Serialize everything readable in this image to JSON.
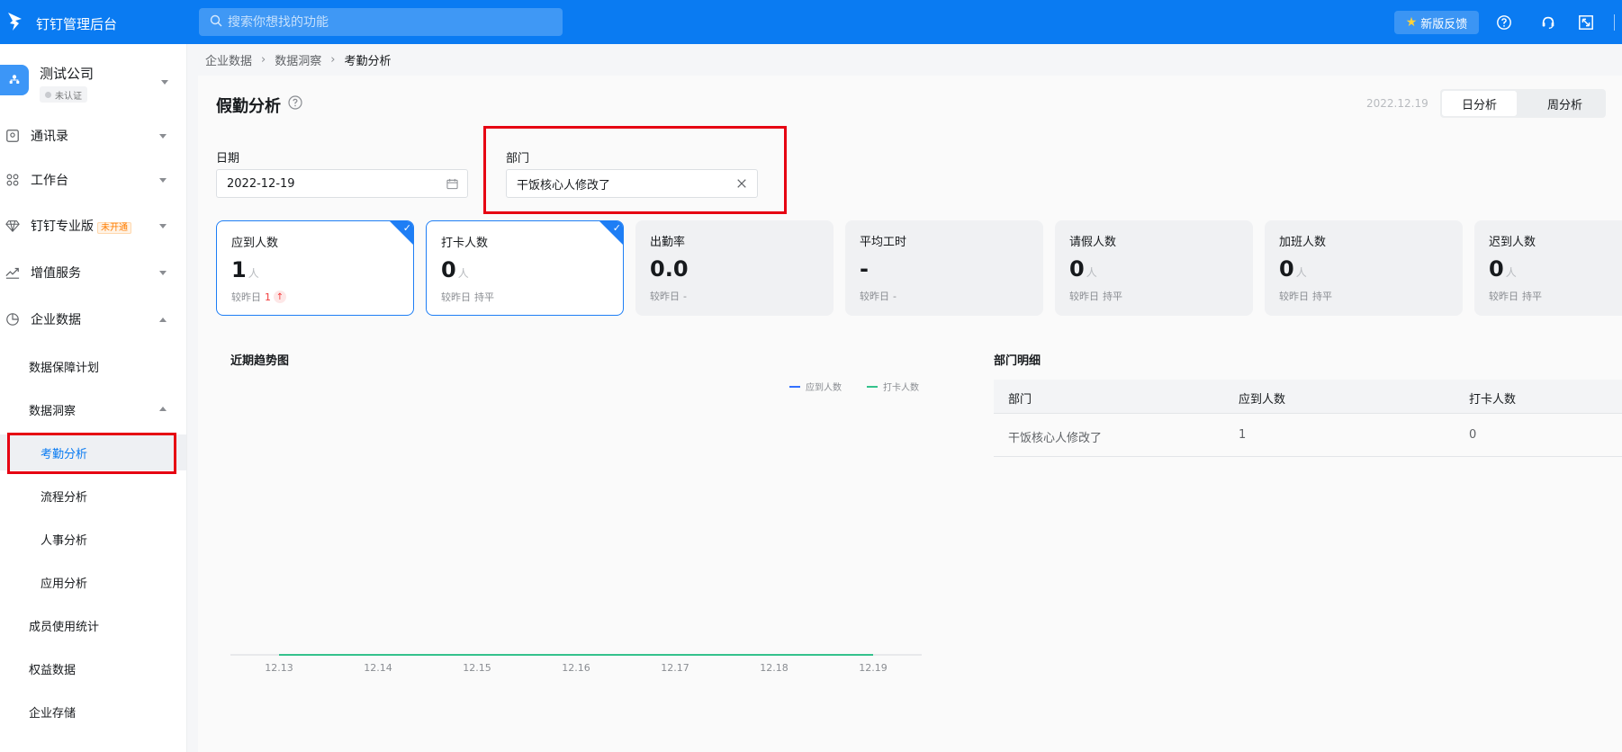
{
  "topbar": {
    "title": "钉钉管理后台",
    "search_placeholder": "搜索你想找的功能",
    "feedback_label": "新版反馈"
  },
  "sidebar": {
    "company_name": "测试公司",
    "company_badge": "未认证",
    "items": [
      {
        "label": "通讯录",
        "icon": "contacts-icon"
      },
      {
        "label": "工作台",
        "icon": "grid-icon"
      },
      {
        "label": "钉钉专业版",
        "icon": "diamond-icon",
        "tag": "未开通"
      },
      {
        "label": "增值服务",
        "icon": "trend-icon"
      },
      {
        "label": "企业数据",
        "icon": "pie-icon"
      }
    ],
    "sub": {
      "data_plan": "数据保障计划",
      "insight": "数据洞察",
      "attendance": "考勤分析",
      "process": "流程分析",
      "hr": "人事分析",
      "app": "应用分析",
      "member_stats": "成员使用统计",
      "benefits": "权益数据",
      "storage": "企业存储"
    }
  },
  "breadcrumb": [
    "企业数据",
    "数据洞察",
    "考勤分析"
  ],
  "page": {
    "title": "假勤分析",
    "date_display": "2022.12.19",
    "tabs": [
      "日分析",
      "周分析"
    ],
    "date_label": "日期",
    "date_value": "2022-12-19",
    "dept_label": "部门",
    "dept_value": "干饭核心人修改了"
  },
  "cards": [
    {
      "title": "应到人数",
      "value": "1",
      "unit": "人",
      "cmp_label": "较昨日",
      "cmp_value": "1",
      "trend": "up",
      "selected": true
    },
    {
      "title": "打卡人数",
      "value": "0",
      "unit": "人",
      "cmp_label": "较昨日",
      "cmp_value": "持平",
      "selected": true
    },
    {
      "title": "出勤率",
      "value": "0.0",
      "unit": "",
      "cmp_label": "较昨日",
      "cmp_value": "-"
    },
    {
      "title": "平均工时",
      "value": "-",
      "unit": "",
      "cmp_label": "较昨日",
      "cmp_value": "-"
    },
    {
      "title": "请假人数",
      "value": "0",
      "unit": "人",
      "cmp_label": "较昨日",
      "cmp_value": "持平"
    },
    {
      "title": "加班人数",
      "value": "0",
      "unit": "人",
      "cmp_label": "较昨日",
      "cmp_value": "持平"
    },
    {
      "title": "迟到人数",
      "value": "0",
      "unit": "人",
      "cmp_label": "较昨日",
      "cmp_value": "持平"
    }
  ],
  "trend": {
    "title": "近期趋势图"
  },
  "chart_data": {
    "type": "line",
    "title": "近期趋势图",
    "categories": [
      "12.13",
      "12.14",
      "12.15",
      "12.16",
      "12.17",
      "12.18",
      "12.19"
    ],
    "series": [
      {
        "name": "应到人数",
        "color": "#3370ff",
        "values": [
          0,
          0,
          0,
          0,
          0,
          0,
          0
        ]
      },
      {
        "name": "打卡人数",
        "color": "#34c28c",
        "values": [
          0,
          0,
          0,
          0,
          0,
          0,
          0
        ]
      }
    ],
    "legend": "top-right",
    "grid": false
  },
  "dept_table": {
    "title": "部门明细",
    "columns": [
      "部门",
      "应到人数",
      "打卡人数"
    ],
    "rows": [
      [
        "干饭核心人修改了",
        "1",
        "0"
      ]
    ]
  },
  "colors": {
    "brand": "#0a7bf2",
    "highlight": "#e60012"
  }
}
